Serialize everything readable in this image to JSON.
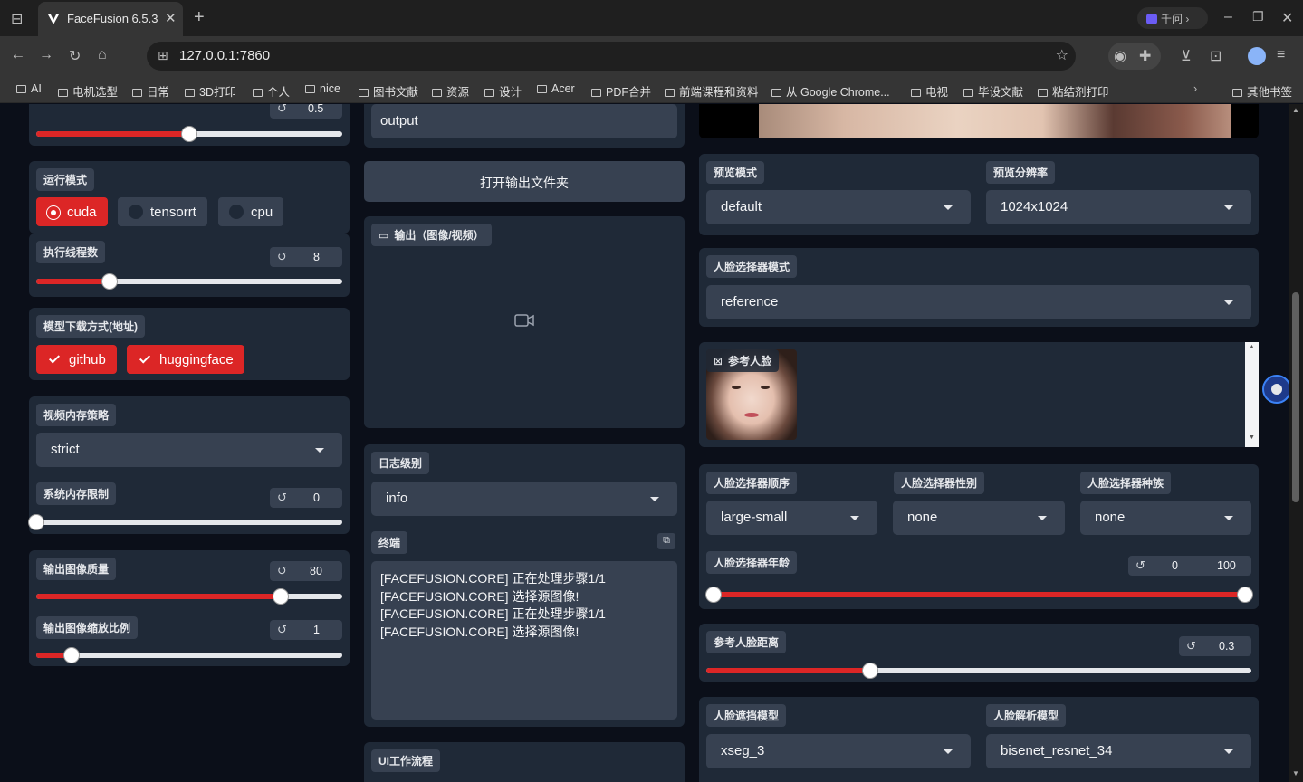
{
  "browser": {
    "tab_title": "FaceFusion 6.5.3",
    "qianwen_label": "千问",
    "url": "127.0.0.1:7860",
    "bookmarks": [
      "AI",
      "电机选型",
      "日常",
      "3D打印",
      "个人",
      "nice",
      "图书文献",
      "资源",
      "设计",
      "Acer",
      "PDF合并",
      "前端课程和资料",
      "从 Google Chrome...",
      "电视",
      "毕设文献",
      "粘结剂打印"
    ],
    "other_bookmarks": "其他书签"
  },
  "left": {
    "top_slider": {
      "value": "0.5",
      "fraction": 0.5
    },
    "execution_providers": {
      "label": "运行模式",
      "options": [
        {
          "label": "cuda",
          "selected": true
        },
        {
          "label": "tensorrt",
          "selected": false
        },
        {
          "label": "cpu",
          "selected": false
        }
      ]
    },
    "thread_count": {
      "label": "执行线程数",
      "value": "8",
      "fraction": 0.24
    },
    "download_providers": {
      "label": "模型下载方式(地址)",
      "options": [
        {
          "label": "github",
          "checked": true
        },
        {
          "label": "huggingface",
          "checked": true
        }
      ]
    },
    "video_memory": {
      "label": "视频内存策略",
      "value": "strict"
    },
    "system_memory": {
      "label": "系统内存限制",
      "value": "0",
      "fraction": 0.0
    },
    "output_image_quality": {
      "label": "输出图像质量",
      "value": "80",
      "fraction": 0.8
    },
    "output_image_scale": {
      "label": "输出图像缩放比例",
      "value": "1",
      "fraction": 0.115
    }
  },
  "middle": {
    "output_path": "output",
    "open_output_button": "打开输出文件夹",
    "output_media_label": "输出（图像/视频）",
    "log_level": {
      "label": "日志级别",
      "value": "info"
    },
    "terminal": {
      "label": "终端",
      "lines": [
        "[FACEFUSION.CORE] 正在处理步骤1/1",
        "[FACEFUSION.CORE] 选择源图像!",
        "[FACEFUSION.CORE] 正在处理步骤1/1",
        "[FACEFUSION.CORE] 选择源图像!"
      ]
    },
    "ui_workflow_label": "UI工作流程"
  },
  "right": {
    "preview_mode": {
      "label": "预览模式",
      "value": "default"
    },
    "preview_resolution": {
      "label": "预览分辨率",
      "value": "1024x1024"
    },
    "face_selector_mode": {
      "label": "人脸选择器模式",
      "value": "reference"
    },
    "reference_face_label": "参考人脸",
    "face_selector_order": {
      "label": "人脸选择器顺序",
      "value": "large-small"
    },
    "face_selector_gender": {
      "label": "人脸选择器性别",
      "value": "none"
    },
    "face_selector_race": {
      "label": "人脸选择器种族",
      "value": "none"
    },
    "face_selector_age": {
      "label": "人脸选择器年龄",
      "min": "0",
      "max": "100",
      "fraction_start": 0.0,
      "fraction_end": 1.0
    },
    "reference_face_distance": {
      "label": "参考人脸距离",
      "value": "0.3",
      "fraction": 0.3
    },
    "face_occluder_model": {
      "label": "人脸遮挡模型",
      "value": "xseg_3"
    },
    "face_parser_model": {
      "label": "人脸解析模型",
      "value": "bisenet_resnet_34"
    }
  },
  "colors": {
    "accent": "#dc2626",
    "panel": "#1f2937",
    "input": "#374151",
    "background": "#0b0f19"
  }
}
